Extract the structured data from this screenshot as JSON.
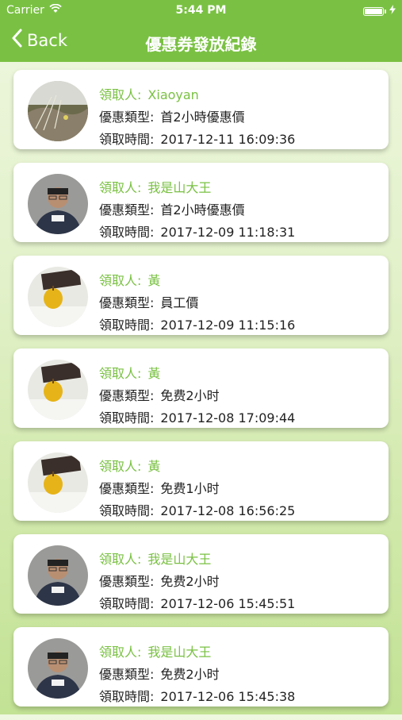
{
  "status_bar": {
    "carrier": "Carrier",
    "time": "5:44 PM"
  },
  "nav": {
    "back_label": "Back",
    "title": "優惠券發放紀錄"
  },
  "labels": {
    "receiver": "領取人:",
    "type": "優惠類型:",
    "time": "領取時間:"
  },
  "records": [
    {
      "avatar": "landscape-photo",
      "receiver": "Xiaoyan",
      "type": "首2小時優惠價",
      "time": "2017-12-11 16:09:36"
    },
    {
      "avatar": "man-photo",
      "receiver": "我是山大王",
      "type": "首2小時優惠價",
      "time": "2017-12-09 11:18:31"
    },
    {
      "avatar": "pear-photo",
      "receiver": "黃",
      "type": "員工價",
      "time": "2017-12-09 11:15:16"
    },
    {
      "avatar": "pear-photo",
      "receiver": "黃",
      "type": "免费2小时",
      "time": "2017-12-08 17:09:44"
    },
    {
      "avatar": "pear-photo",
      "receiver": "黃",
      "type": "免费1小时",
      "time": "2017-12-08 16:56:25"
    },
    {
      "avatar": "man-photo",
      "receiver": "我是山大王",
      "type": "免费2小时",
      "time": "2017-12-06 15:45:51"
    },
    {
      "avatar": "man-photo",
      "receiver": "我是山大王",
      "type": "免费2小时",
      "time": "2017-12-06 15:45:38"
    }
  ],
  "colors": {
    "brand_green": "#7ac143",
    "card_bg": "#ffffff",
    "text": "#222222"
  }
}
